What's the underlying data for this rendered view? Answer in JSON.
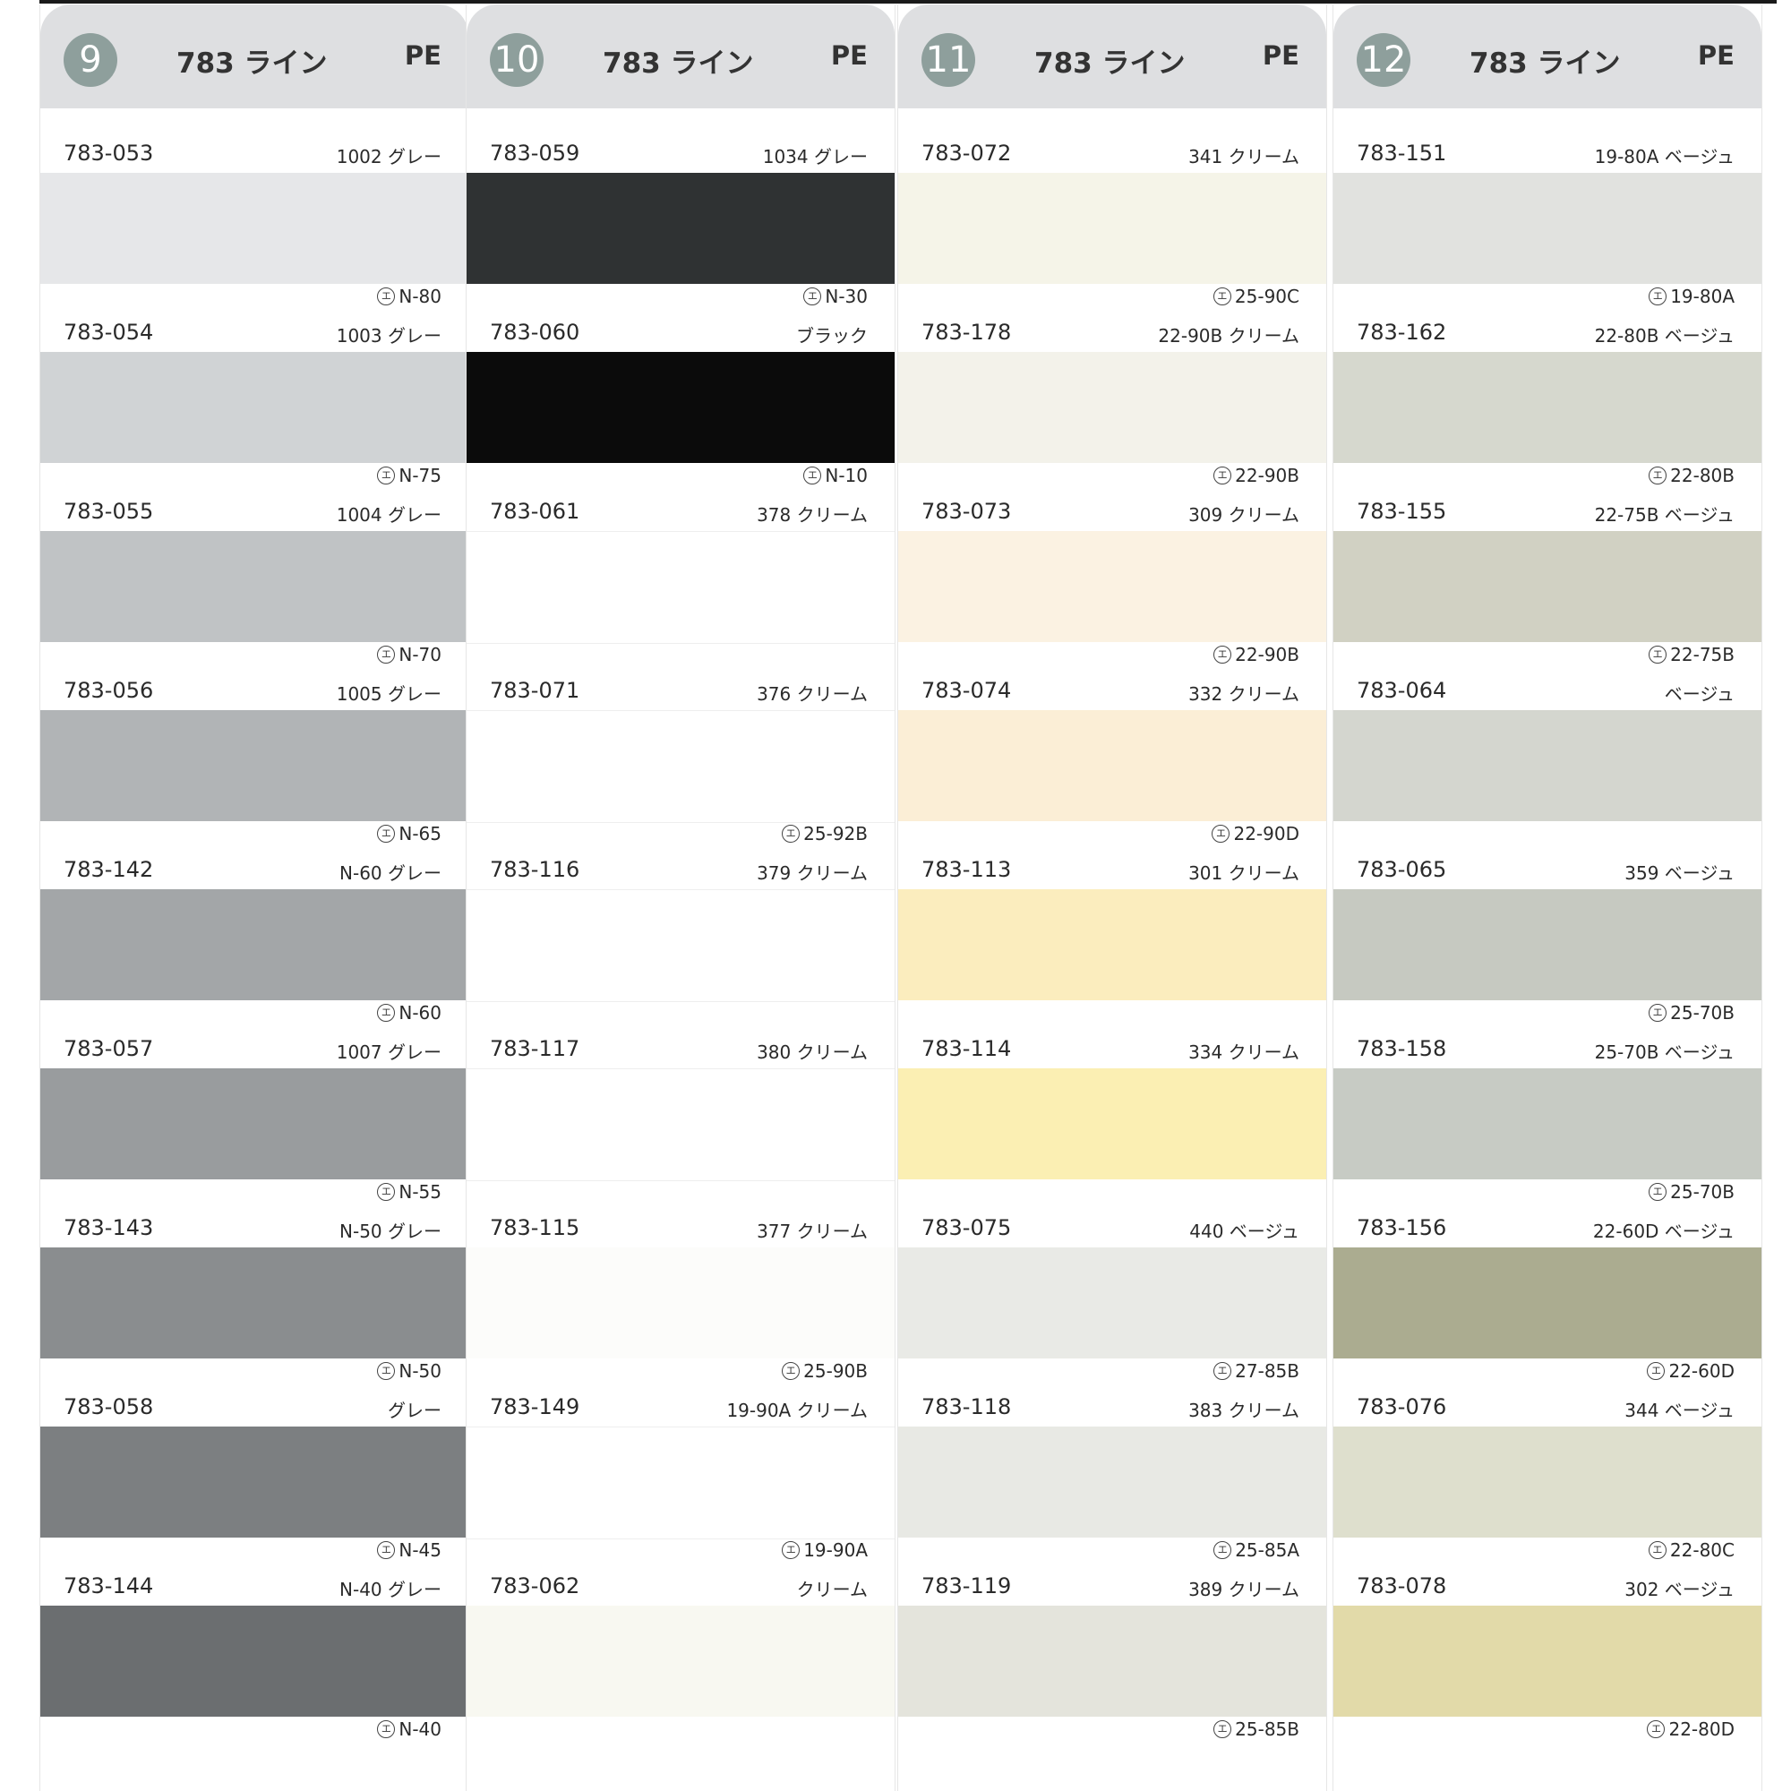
{
  "columns": [
    {
      "number": "9",
      "title": "783 ライン",
      "material": "PE",
      "items": [
        {
          "code": "783-053",
          "desc": "1002 グレー",
          "color": "#e6e7e9",
          "ref": "N-80"
        },
        {
          "code": "783-054",
          "desc": "1003 グレー",
          "color": "#d0d3d5",
          "ref": "N-75"
        },
        {
          "code": "783-055",
          "desc": "1004 グレー",
          "color": "#c0c3c5",
          "ref": "N-70"
        },
        {
          "code": "783-056",
          "desc": "1005 グレー",
          "color": "#b1b4b6",
          "ref": "N-65"
        },
        {
          "code": "783-142",
          "desc": "N-60 グレー",
          "color": "#a3a6a8",
          "ref": "N-60"
        },
        {
          "code": "783-057",
          "desc": "1007 グレー",
          "color": "#999c9e",
          "ref": "N-55"
        },
        {
          "code": "783-143",
          "desc": "N-50 グレー",
          "color": "#8a8d8f",
          "ref": "N-50"
        },
        {
          "code": "783-058",
          "desc": "グレー",
          "color": "#7c7f81",
          "ref": "N-45"
        },
        {
          "code": "783-144",
          "desc": "N-40 グレー",
          "color": "#6b6e70",
          "ref": "N-40"
        }
      ]
    },
    {
      "number": "10",
      "title": "783 ライン",
      "material": "PE",
      "items": [
        {
          "code": "783-059",
          "desc": "1034 グレー",
          "color": "#2f3233",
          "ref": "N-30"
        },
        {
          "code": "783-060",
          "desc": "ブラック",
          "color": "#0b0b0b",
          "ref": "N-10"
        },
        {
          "code": "783-061",
          "desc": "378 クリーム",
          "color": "#ffffff",
          "ref": ""
        },
        {
          "code": "783-071",
          "desc": "376 クリーム",
          "color": "#ffffff",
          "ref": "25-92B"
        },
        {
          "code": "783-116",
          "desc": "379 クリーム",
          "color": "#ffffff",
          "ref": ""
        },
        {
          "code": "783-117",
          "desc": "380 クリーム",
          "color": "#ffffff",
          "ref": ""
        },
        {
          "code": "783-115",
          "desc": "377 クリーム",
          "color": "#fcfcfa",
          "ref": "25-90B"
        },
        {
          "code": "783-149",
          "desc": "19-90A クリーム",
          "color": "#ffffff",
          "ref": "19-90A"
        },
        {
          "code": "783-062",
          "desc": "クリーム",
          "color": "#f8f8f1",
          "ref": ""
        }
      ]
    },
    {
      "number": "11",
      "title": "783 ライン",
      "material": "PE",
      "items": [
        {
          "code": "783-072",
          "desc": "341 クリーム",
          "color": "#f5f4e8",
          "ref": "25-90C"
        },
        {
          "code": "783-178",
          "desc": "22-90B クリーム",
          "color": "#f3f2ea",
          "ref": "22-90B"
        },
        {
          "code": "783-073",
          "desc": "309 クリーム",
          "color": "#fbf2e2",
          "ref": "22-90B"
        },
        {
          "code": "783-074",
          "desc": "332 クリーム",
          "color": "#fbeed6",
          "ref": "22-90D"
        },
        {
          "code": "783-113",
          "desc": "301 クリーム",
          "color": "#fbedbe",
          "ref": ""
        },
        {
          "code": "783-114",
          "desc": "334 クリーム",
          "color": "#fbefb3",
          "ref": ""
        },
        {
          "code": "783-075",
          "desc": "440 ベージュ",
          "color": "#e9eae6",
          "ref": "27-85B"
        },
        {
          "code": "783-118",
          "desc": "383 クリーム",
          "color": "#e8e9e4",
          "ref": "25-85A"
        },
        {
          "code": "783-119",
          "desc": "389 クリーム",
          "color": "#e4e4dc",
          "ref": "25-85B"
        }
      ]
    },
    {
      "number": "12",
      "title": "783 ライン",
      "material": "PE",
      "items": [
        {
          "code": "783-151",
          "desc": "19-80A ベージュ",
          "color": "#e1e2df",
          "ref": "19-80A"
        },
        {
          "code": "783-162",
          "desc": "22-80B ベージュ",
          "color": "#d6d8ce",
          "ref": "22-80B"
        },
        {
          "code": "783-155",
          "desc": "22-75B ベージュ",
          "color": "#d1d1c3",
          "ref": "22-75B"
        },
        {
          "code": "783-064",
          "desc": "ベージュ",
          "color": "#d4d6cf",
          "ref": ""
        },
        {
          "code": "783-065",
          "desc": "359 ベージュ",
          "color": "#c6c9c1",
          "ref": "25-70B"
        },
        {
          "code": "783-158",
          "desc": "25-70B ベージュ",
          "color": "#c7cbc4",
          "ref": "25-70B"
        },
        {
          "code": "783-156",
          "desc": "22-60D ベージュ",
          "color": "#abac90",
          "ref": "22-60D"
        },
        {
          "code": "783-076",
          "desc": "344 ベージュ",
          "color": "#dedfcd",
          "ref": "22-80C"
        },
        {
          "code": "783-078",
          "desc": "302 ベージュ",
          "color": "#e2daa9",
          "ref": "22-80D"
        }
      ]
    }
  ]
}
